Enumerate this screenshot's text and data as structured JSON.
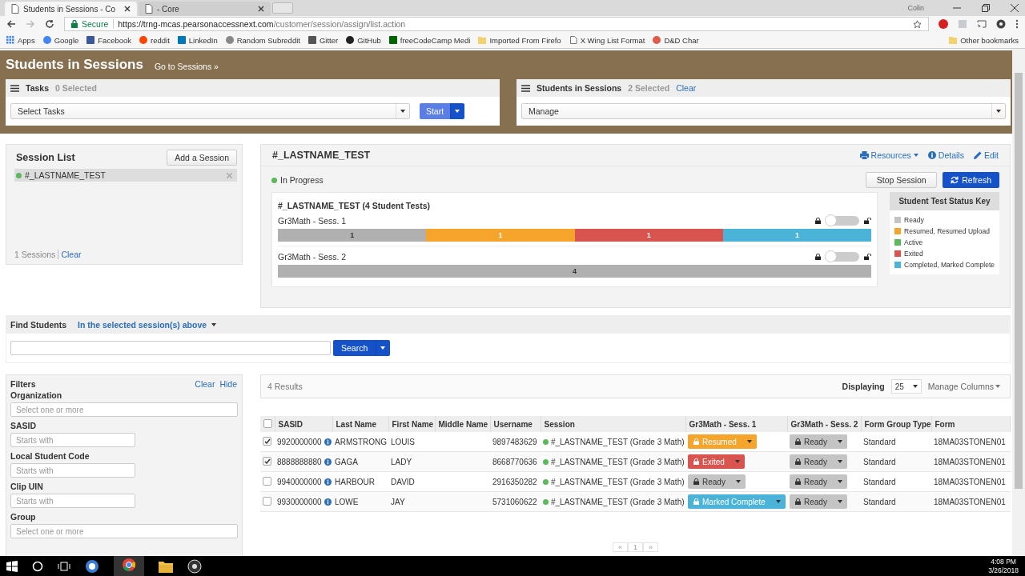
{
  "browser": {
    "tabs": [
      {
        "title": "Students in Sessions - Co",
        "selected": true
      },
      {
        "title": "- Core",
        "selected": false
      }
    ],
    "user": "Colin",
    "secure": "Secure",
    "url_host": "https://trng-mcas.pearsonaccessnext.com",
    "url_path": "/customer/session/assign/list.action",
    "bookmarks": [
      {
        "label": "Apps",
        "kind": "grid",
        "color": "#4285f4"
      },
      {
        "label": "Google",
        "kind": "circle",
        "color": "#4285f4"
      },
      {
        "label": "Facebook",
        "kind": "square",
        "color": "#3b5998"
      },
      {
        "label": "reddit",
        "kind": "circle",
        "color": "#ff4500"
      },
      {
        "label": "LinkedIn",
        "kind": "square",
        "color": "#0077b5"
      },
      {
        "label": "Random Subreddit",
        "kind": "circle",
        "color": "#888888"
      },
      {
        "label": "Gitter",
        "kind": "square",
        "color": "#555555"
      },
      {
        "label": "GitHub",
        "kind": "circle",
        "color": "#222222"
      },
      {
        "label": "freeCodeCamp Medi",
        "kind": "square",
        "color": "#006400"
      },
      {
        "label": "Imported From Firefo",
        "kind": "folder",
        "color": "#f4d26b"
      },
      {
        "label": "X Wing List Format",
        "kind": "page",
        "color": "#777777"
      },
      {
        "label": "D&D Char",
        "kind": "circle",
        "color": "#e05a4a"
      }
    ],
    "other_bookmarks": "Other bookmarks"
  },
  "header": {
    "title": "Students in Sessions",
    "link": "Go to Sessions »"
  },
  "tasks_panel": {
    "title": "Tasks",
    "count": "0 Selected",
    "select": "Select Tasks",
    "button": "Start"
  },
  "students_panel": {
    "title": "Students in Sessions",
    "count": "2 Selected",
    "clear": "Clear",
    "select": "Manage"
  },
  "session_list": {
    "title": "Session List",
    "add_button": "Add a Session",
    "items": [
      {
        "name": "#_LASTNAME_TEST",
        "selected": true,
        "color": "#5cb85c"
      }
    ],
    "count": "1 Sessions",
    "clear": "Clear"
  },
  "session": {
    "title": "#_LASTNAME_TEST",
    "links": [
      {
        "label": "Resources",
        "kind": "print"
      },
      {
        "label": "Details",
        "kind": "info"
      },
      {
        "label": "Edit",
        "kind": "pencil"
      }
    ],
    "status": "In Progress",
    "buttons": [
      {
        "label": "Stop Session",
        "kind": "default"
      },
      {
        "label": "Refresh",
        "kind": "primary"
      }
    ],
    "tests_title": "#_LASTNAME_TEST (4 Student Tests)",
    "tests": [
      {
        "name": "Gr3Math - Sess. 1",
        "on": false,
        "segments": [
          {
            "count": "1",
            "color": "#b0b0b0"
          },
          {
            "count": "1",
            "color": "#f5a42c"
          },
          {
            "count": "1",
            "color": "#d9534f"
          },
          {
            "count": "1",
            "color": "#4bb3d8"
          }
        ]
      },
      {
        "name": "Gr3Math - Sess. 2",
        "on": false,
        "segments": [
          {
            "count": "4",
            "color": "#b0b0b0"
          }
        ]
      }
    ],
    "key": {
      "title": "Student Test Status Key",
      "items": [
        {
          "label": "Ready",
          "color": "#c4c4c4"
        },
        {
          "label": "Resumed, Resumed Upload",
          "color": "#f5a42c"
        },
        {
          "label": "Active",
          "color": "#5cb85c"
        },
        {
          "label": "Exited",
          "color": "#d9534f"
        },
        {
          "label": "Completed, Marked Complete",
          "color": "#4bb3d8"
        }
      ]
    }
  },
  "find": {
    "title": "Find Students",
    "scope": "In the selected session(s) above",
    "button": "Search"
  },
  "filters": {
    "title": "Filters",
    "clear": "Clear",
    "hide": "Hide",
    "fields": [
      {
        "label": "Organization",
        "placeholder": "Select one or more",
        "kind": "wide"
      },
      {
        "label": "SASID",
        "placeholder": "Starts with",
        "kind": "narrow"
      },
      {
        "label": "Local Student Code",
        "placeholder": "Starts with",
        "kind": "narrow"
      },
      {
        "label": "Clip UIN",
        "placeholder": "Starts with",
        "kind": "narrow"
      },
      {
        "label": "Group",
        "placeholder": "Select one or more",
        "kind": "wide"
      }
    ]
  },
  "results": {
    "count": "4 Results",
    "displaying": "Displaying",
    "page_size": "25",
    "manage_columns": "Manage Columns",
    "all_selected": false,
    "columns": [
      "SASID",
      "Last Name",
      "First Name",
      "Middle Name",
      "Username",
      "Session",
      "Gr3Math - Sess. 1",
      "Gr3Math - Sess. 2",
      "Form Group Type",
      "Form"
    ],
    "rows": [
      {
        "selected": true,
        "sasid": "9920000000",
        "last": "ARMSTRONG",
        "first": "LOUIS",
        "username": "9897483629",
        "session": "#_LASTNAME_TEST (Grade 3 Math)",
        "sess1": {
          "label": "Resumed",
          "kind": "resumed"
        },
        "sess2": {
          "label": "Ready",
          "kind": "ready"
        },
        "form_group_type": "Standard",
        "form": "18MA03STONEN01"
      },
      {
        "selected": true,
        "sasid": "8888888880",
        "last": "GAGA",
        "first": "LADY",
        "username": "8668770636",
        "session": "#_LASTNAME_TEST (Grade 3 Math)",
        "sess1": {
          "label": "Exited",
          "kind": "exited"
        },
        "sess2": {
          "label": "Ready",
          "kind": "ready"
        },
        "form_group_type": "Standard",
        "form": "18MA03STONEN01"
      },
      {
        "selected": false,
        "sasid": "9940000000",
        "last": "HARBOUR",
        "first": "DAVID",
        "username": "2916350282",
        "session": "#_LASTNAME_TEST (Grade 3 Math)",
        "sess1": {
          "label": "Ready",
          "kind": "ready"
        },
        "sess2": {
          "label": "Ready",
          "kind": "ready"
        },
        "form_group_type": "Standard",
        "form": "18MA03STONEN01"
      },
      {
        "selected": false,
        "sasid": "9930000000",
        "last": "LOWE",
        "first": "JAY",
        "username": "5731060622",
        "session": "#_LASTNAME_TEST (Grade 3 Math)",
        "sess1": {
          "label": "Marked Complete",
          "kind": "complete"
        },
        "sess2": {
          "label": "Ready",
          "kind": "ready"
        },
        "form_group_type": "Standard",
        "form": "18MA03STONEN01"
      }
    ],
    "pagination": [
      "«",
      "1",
      "»"
    ]
  },
  "taskbar": {
    "time": "4:08 PM",
    "date": "3/26/2018"
  }
}
